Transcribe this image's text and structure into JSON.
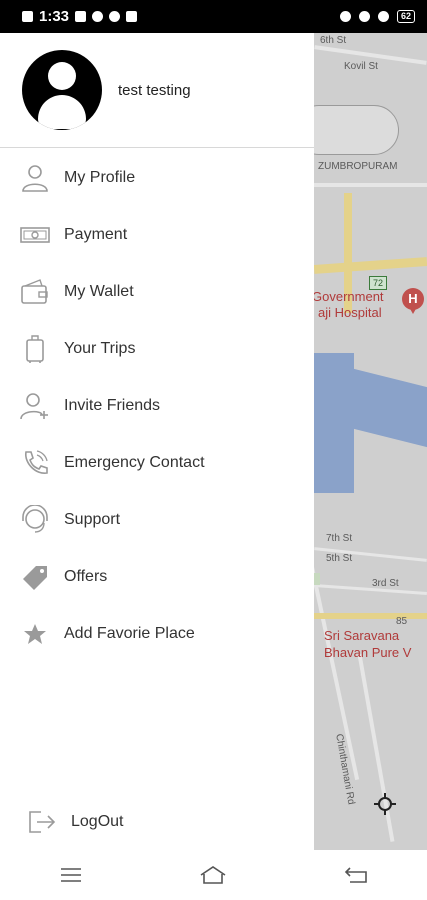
{
  "status_bar": {
    "time": "1:33",
    "battery": "62"
  },
  "drawer": {
    "user_name": "test testing",
    "menu_items": [
      {
        "label": "My Profile",
        "icon": "user-icon"
      },
      {
        "label": "Payment",
        "icon": "cash-icon"
      },
      {
        "label": "My Wallet",
        "icon": "wallet-icon"
      },
      {
        "label": "Your Trips",
        "icon": "luggage-icon"
      },
      {
        "label": "Invite Friends",
        "icon": "add-user-icon"
      },
      {
        "label": "Emergency Contact",
        "icon": "phone-call-icon"
      },
      {
        "label": "Support",
        "icon": "headset-icon"
      },
      {
        "label": "Offers",
        "icon": "tag-icon"
      },
      {
        "label": "Add Favorie Place",
        "icon": "star-icon"
      }
    ],
    "logout_label": "LogOut"
  },
  "map": {
    "labels": {
      "street_6th": "6th St",
      "kovil_st": "Kovil St",
      "area": "ZUMBROPURAM",
      "route_shield": "72",
      "hospital_line1": "Government",
      "hospital_line2": "aji Hospital",
      "hospital_marker": "H",
      "street_7th": "7th St",
      "street_5th": "5th St",
      "street_3rd": "3rd St",
      "number": "85",
      "restaurant_line1": "Sri Saravana",
      "restaurant_line2": "Bhavan Pure V",
      "chinthamani_rd": "Chinthamani Rd"
    }
  },
  "colors": {
    "status_bar": "#000000",
    "map_dim": "#cfcfcf",
    "drawer_bg": "#ffffff",
    "icon_gray": "#9a9a9a"
  }
}
